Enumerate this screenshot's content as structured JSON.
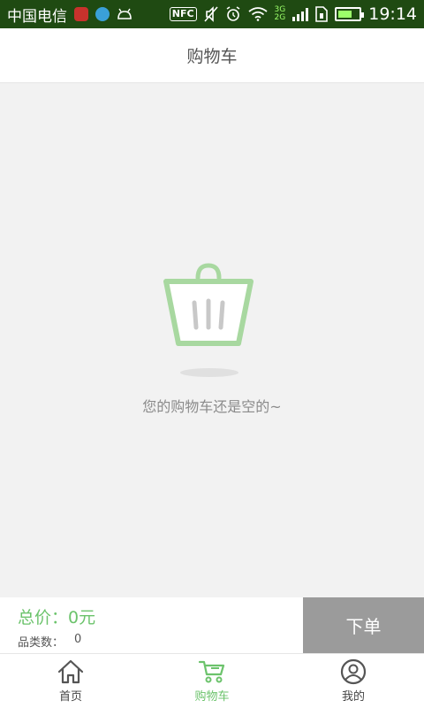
{
  "status_bar": {
    "carrier": "中国电信",
    "network_top": "3G",
    "network_bottom": "2G",
    "nfc": "NFC",
    "time": "19:14",
    "battery_level": 0.7,
    "icons": [
      "app-icon-red",
      "app-icon-blue",
      "android-icon",
      "nfc-icon",
      "mute-icon",
      "alarm-icon",
      "wifi-icon",
      "signal-icon",
      "sim-icon",
      "battery-icon"
    ]
  },
  "header": {
    "title": "购物车"
  },
  "empty_state": {
    "icon": "basket-icon",
    "message": "您的购物车还是空的~",
    "accent_color": "#a8d8a0"
  },
  "summary": {
    "total_label": "总价：",
    "total_value": "0元",
    "count_label": "品类数：",
    "count_value": "0",
    "order_button": "下单"
  },
  "tabbar": {
    "items": [
      {
        "label": "首页",
        "icon": "home-icon",
        "active": false
      },
      {
        "label": "购物车",
        "icon": "cart-icon",
        "active": true
      },
      {
        "label": "我的",
        "icon": "user-icon",
        "active": false
      }
    ]
  },
  "colors": {
    "accent": "#6cc36c",
    "status_bar": "#1f4a12",
    "button_disabled": "#9b9b9b"
  }
}
